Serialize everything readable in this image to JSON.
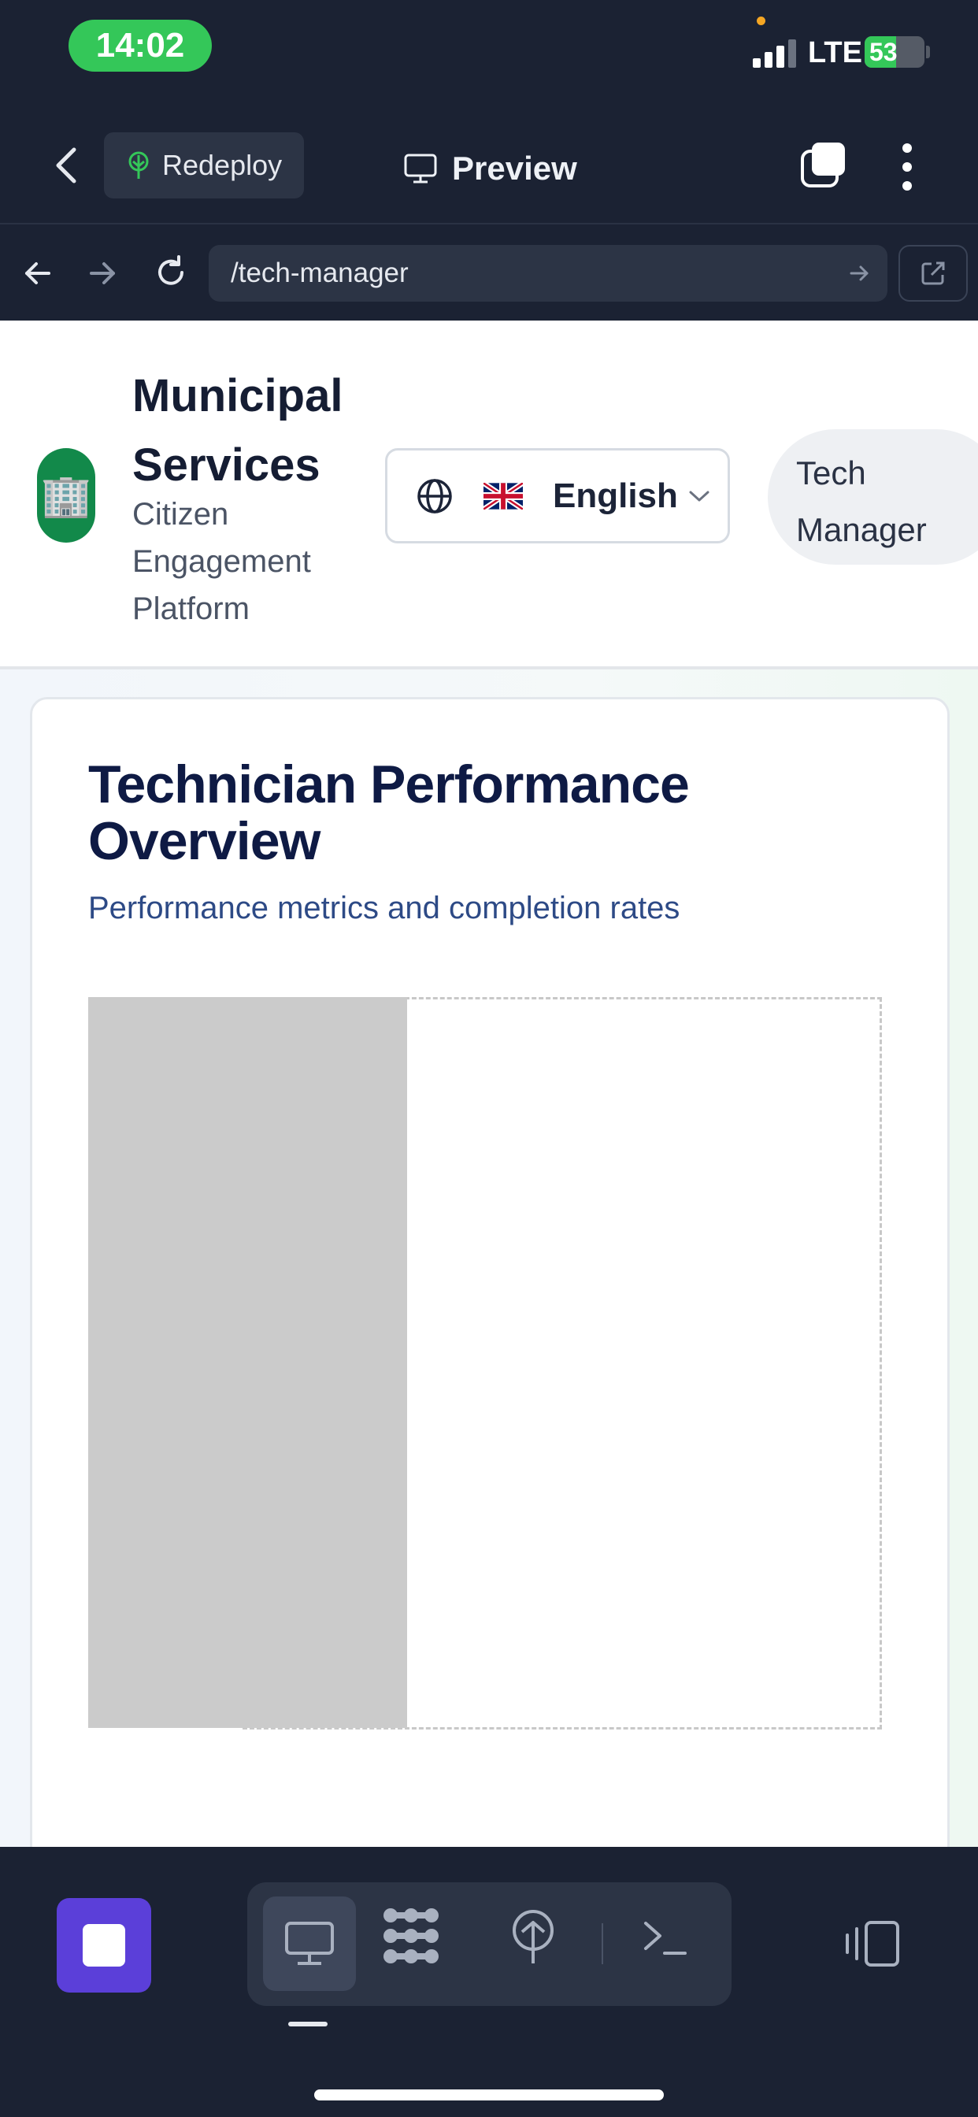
{
  "status_bar": {
    "time": "14:02",
    "network": "LTE",
    "battery": "53",
    "battery_level": 0.53
  },
  "toolbar": {
    "redeploy_label": "Redeploy",
    "preview_label": "Preview"
  },
  "browser": {
    "url": "/tech-manager"
  },
  "site": {
    "brand_title": "Municipal Services",
    "brand_subtitle": "Citizen Engagement Platform",
    "logo_icon": "building-icon",
    "language": "English",
    "role": "Tech Manager"
  },
  "card": {
    "title": "Technician Performance Overview",
    "subtitle": "Performance metrics and completion rates"
  },
  "colors": {
    "accent": "#5b3fd9",
    "status_green": "#34c759",
    "logo_green": "#12894a",
    "title_navy": "#0e1a44"
  }
}
